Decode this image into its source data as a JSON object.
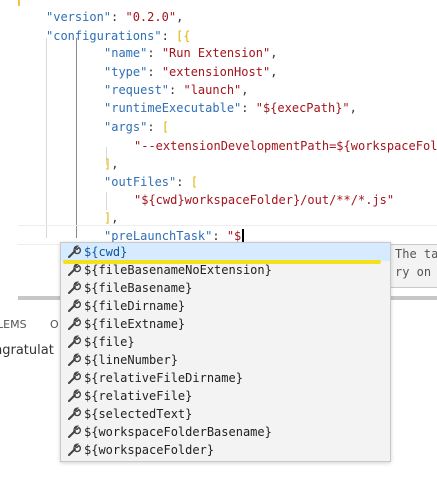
{
  "editor": {
    "lines": [
      {
        "tokens": [
          {
            "t": "\"version\"",
            "c": "k"
          },
          {
            "t": ": ",
            "c": "p"
          },
          {
            "t": "\"0.2.0\"",
            "c": "s"
          },
          {
            "t": ",",
            "c": "p"
          }
        ]
      },
      {
        "tokens": [
          {
            "t": "\"configurations\"",
            "c": "k"
          },
          {
            "t": ": ",
            "c": "p"
          },
          {
            "t": "[{",
            "c": "b"
          }
        ]
      },
      {
        "tokens": [
          {
            "t": "\"name\"",
            "c": "k"
          },
          {
            "t": ": ",
            "c": "p"
          },
          {
            "t": "\"Run Extension\"",
            "c": "s"
          },
          {
            "t": ",",
            "c": "p"
          }
        ]
      },
      {
        "tokens": [
          {
            "t": "\"type\"",
            "c": "k"
          },
          {
            "t": ": ",
            "c": "p"
          },
          {
            "t": "\"extensionHost\"",
            "c": "s"
          },
          {
            "t": ",",
            "c": "p"
          }
        ]
      },
      {
        "tokens": [
          {
            "t": "\"request\"",
            "c": "k"
          },
          {
            "t": ": ",
            "c": "p"
          },
          {
            "t": "\"launch\"",
            "c": "s"
          },
          {
            "t": ",",
            "c": "p"
          }
        ]
      },
      {
        "tokens": [
          {
            "t": "\"runtimeExecutable\"",
            "c": "k"
          },
          {
            "t": ": ",
            "c": "p"
          },
          {
            "t": "\"${execPath}\"",
            "c": "s"
          },
          {
            "t": ",",
            "c": "p"
          }
        ]
      },
      {
        "tokens": [
          {
            "t": "\"args\"",
            "c": "k"
          },
          {
            "t": ": ",
            "c": "p"
          },
          {
            "t": "[",
            "c": "b"
          }
        ]
      },
      {
        "tokens": [
          {
            "t": "\"--extensionDevelopmentPath=${workspaceFolder}\"",
            "c": "s"
          }
        ]
      },
      {
        "tokens": [
          {
            "t": "]",
            "c": "b"
          },
          {
            "t": ",",
            "c": "p"
          }
        ]
      },
      {
        "tokens": [
          {
            "t": "\"outFiles\"",
            "c": "k"
          },
          {
            "t": ": ",
            "c": "p"
          },
          {
            "t": "[",
            "c": "b"
          }
        ]
      },
      {
        "tokens": [
          {
            "t": "\"${cwd}workspaceFolder}/out/**/*.js\"",
            "c": "s"
          }
        ]
      },
      {
        "tokens": [
          {
            "t": "]",
            "c": "b"
          },
          {
            "t": ",",
            "c": "p"
          }
        ]
      },
      {
        "tokens": [
          {
            "t": "\"preLaunchTask\"",
            "c": "k"
          },
          {
            "t": ": ",
            "c": "p"
          },
          {
            "t": "\"$",
            "c": "s"
          }
        ]
      }
    ]
  },
  "panel": {
    "tab_problems": "LEMS",
    "tab_output": "O",
    "text": "ngratulat"
  },
  "suggest": {
    "items": [
      "${cwd}",
      "${fileBasenameNoExtension}",
      "${fileBasename}",
      "${fileDirname}",
      "${fileExtname}",
      "${file}",
      "${lineNumber}",
      "${relativeFileDirname}",
      "${relativeFile}",
      "${selectedText}",
      "${workspaceFolderBasename}",
      "${workspaceFolder}"
    ],
    "icon": "wrench-icon",
    "selected_index": 0
  },
  "details": {
    "line1": "The ta",
    "line2": "ry on"
  },
  "colors": {
    "keyword": "#2f6fb5",
    "string": "#a3151d",
    "bracket": "#e1b300",
    "selection": "#d6ebff",
    "highlight_bar": "#f3e11d"
  }
}
